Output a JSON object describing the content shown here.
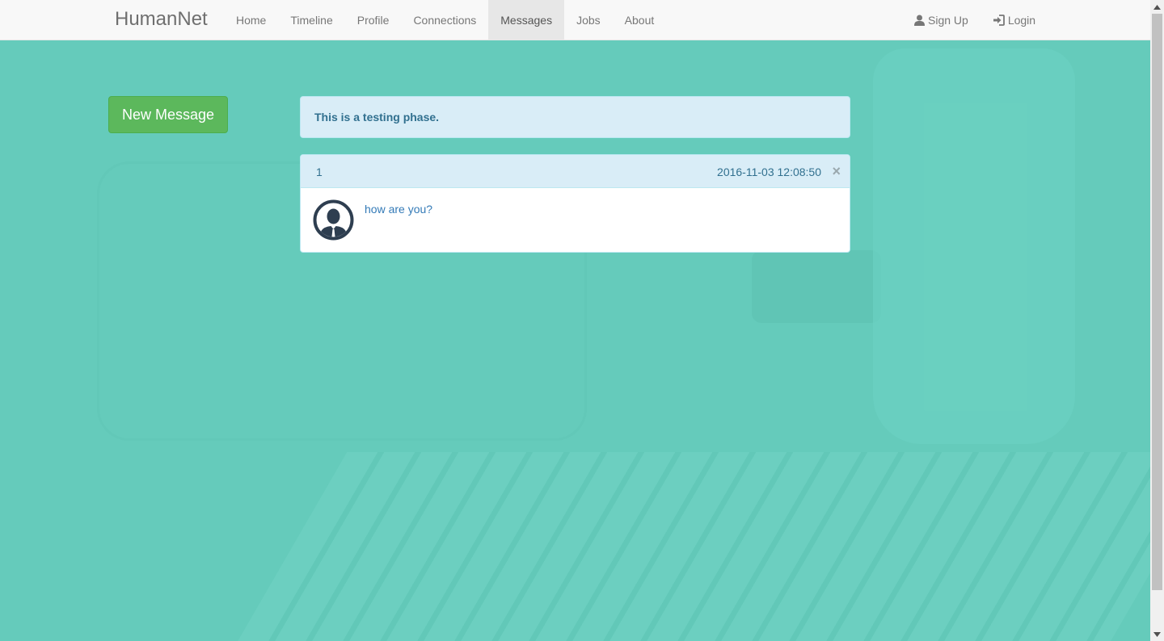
{
  "navbar": {
    "brand": "HumanNet",
    "items": [
      {
        "label": "Home",
        "active": false
      },
      {
        "label": "Timeline",
        "active": false
      },
      {
        "label": "Profile",
        "active": false
      },
      {
        "label": "Connections",
        "active": false
      },
      {
        "label": "Messages",
        "active": true
      },
      {
        "label": "Jobs",
        "active": false
      },
      {
        "label": "About",
        "active": false
      }
    ],
    "right_items": [
      {
        "label": "Sign Up",
        "icon": "user-icon"
      },
      {
        "label": "Login",
        "icon": "login-icon"
      }
    ]
  },
  "sidebar": {
    "new_message_label": "New Message"
  },
  "alert": {
    "text": "This is a testing phase."
  },
  "message": {
    "id": "1",
    "timestamp": "2016-11-03 12:08:50",
    "close_glyph": "×",
    "text": "how are you?",
    "avatar_icon": "user-avatar-icon"
  },
  "colors": {
    "background": "#65cbbb",
    "navbar": "#f8f8f8",
    "button": "#5cb85c",
    "alert_bg": "#d9edf7",
    "alert_text": "#31708f",
    "link": "#337ab7"
  }
}
